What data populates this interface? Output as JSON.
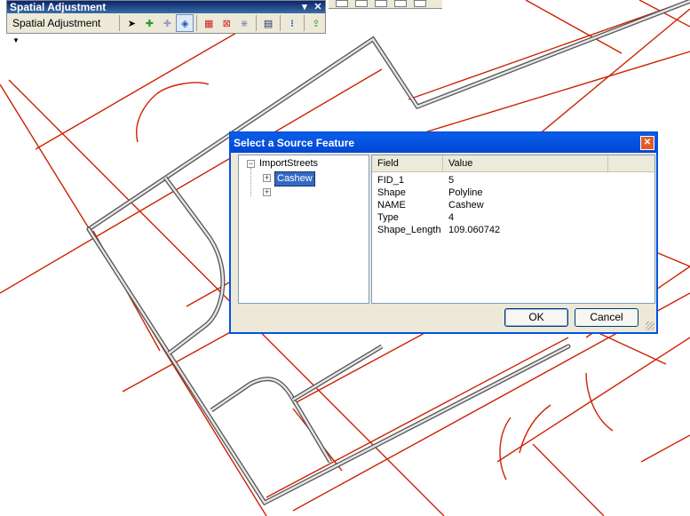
{
  "toolbar": {
    "title": "Spatial Adjustment",
    "dropdown_label": "Spatial Adjustment",
    "pin_glyph": "▾",
    "close_glyph": "✕",
    "tools": [
      {
        "name": "select-elements-icon",
        "glyph": "➤"
      },
      {
        "name": "new-displacement-link-icon",
        "glyph": "✚"
      },
      {
        "name": "modify-link-icon",
        "glyph": "✚"
      },
      {
        "name": "select-source-features-icon",
        "glyph": "◈"
      },
      {
        "name": "new-multiple-links-icon",
        "glyph": "▦"
      },
      {
        "name": "new-limited-adjustment-icon",
        "glyph": "⊠"
      },
      {
        "name": "new-identity-link-icon",
        "glyph": "⋇"
      },
      {
        "name": "view-link-table-icon",
        "glyph": "▤"
      },
      {
        "name": "edge-match-icon",
        "glyph": "⁝"
      },
      {
        "name": "attribute-transfer-icon",
        "glyph": "⇪"
      }
    ]
  },
  "dialog": {
    "title": "Select a Source Feature",
    "close_glyph": "✕",
    "tree": {
      "root": "ImportStreets",
      "root_expander": "−",
      "children": [
        {
          "label": "Cashew",
          "expander": "+"
        },
        {
          "label": "",
          "expander": "+"
        }
      ]
    },
    "grid": {
      "headers": [
        "Field",
        "Value"
      ],
      "rows": [
        {
          "field": "FID_1",
          "value": "5"
        },
        {
          "field": "Shape",
          "value": "Polyline"
        },
        {
          "field": "NAME",
          "value": "Cashew"
        },
        {
          "field": "Type",
          "value": "4"
        },
        {
          "field": "Shape_Length",
          "value": "109.060742"
        }
      ]
    },
    "ok_label": "OK",
    "cancel_label": "Cancel"
  },
  "colors": {
    "parcel_lines": "#cc2200",
    "street_casing": "#555555",
    "street_fill": "#e6e6e6",
    "dialog_title": "#0054e3",
    "selection": "#316ac5"
  }
}
